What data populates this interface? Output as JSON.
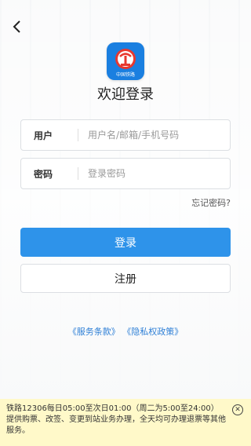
{
  "header": {
    "back_icon": "chevron-left-icon"
  },
  "logo": {
    "text": "中国铁路",
    "color": "#1a7fe0"
  },
  "title": "欢迎登录",
  "form": {
    "user": {
      "label": "用户",
      "placeholder": "用户名/邮箱/手机号码",
      "value": ""
    },
    "password": {
      "label": "密码",
      "placeholder": "登录密码",
      "value": ""
    },
    "forgot": "忘记密码?"
  },
  "buttons": {
    "login": "登录",
    "register": "注册",
    "accent": "#2e93ea"
  },
  "links": {
    "service": "《服务条款》",
    "privacy": "《隐私权政策》"
  },
  "notice": {
    "text": "铁路12306每日05:00至次日01:00（周二为5:00至24:00）提供购票、改签、变更到站业务办理，全天均可办理退票等其他服务。",
    "background": "#fff9c9"
  }
}
